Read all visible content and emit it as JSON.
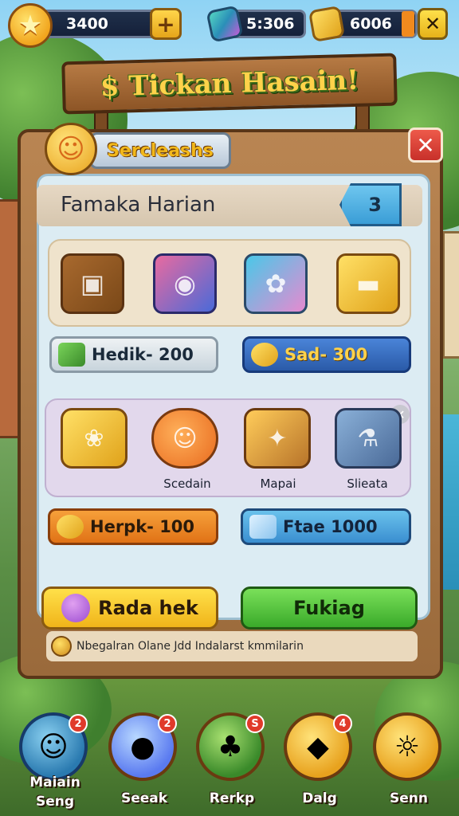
{
  "top_bar": {
    "stars": "3400",
    "gems": "5:306",
    "gold": "6006",
    "plus_label": "+",
    "close_label": "✕"
  },
  "title": "$ Tickan Hasain!",
  "panel": {
    "header_label": "Sercleashs",
    "close_label": "✕",
    "daily_title": "Famaka Harian",
    "daily_count": "3",
    "row1_items": [
      {
        "name": "wooden-chest",
        "glyph": "▣"
      },
      {
        "name": "camera-box",
        "glyph": "◉"
      },
      {
        "name": "treasure-cart",
        "glyph": "✿"
      },
      {
        "name": "gold-cart",
        "glyph": "▬"
      }
    ],
    "row1_buttons": [
      {
        "label": "Hedik- 200"
      },
      {
        "label": "Sad- 300"
      }
    ],
    "row2_items": [
      {
        "name": "gift-box",
        "glyph": "❀",
        "label": ""
      },
      {
        "name": "fox-creature",
        "glyph": "☺",
        "label": "Scedain"
      },
      {
        "name": "magic-box",
        "glyph": "✦",
        "label": "Mapai"
      },
      {
        "name": "cauldron",
        "glyph": "⚗",
        "label": "Slieata"
      }
    ],
    "row2_buttons": [
      {
        "label": "Herpk- 100"
      },
      {
        "label": "Ftae 1000"
      }
    ],
    "action_left": "Rada hek",
    "action_right": "Fukiag",
    "footnote": "Nbegalran Olane Jdd Indalarst kmmilarin"
  },
  "nav": [
    {
      "label": "Maiain Seng",
      "badge": "2"
    },
    {
      "label": "Seeak",
      "badge": "2"
    },
    {
      "label": "Rerkp",
      "badge": "S"
    },
    {
      "label": "Dalg",
      "badge": "4"
    },
    {
      "label": "Senn",
      "badge": ""
    }
  ]
}
